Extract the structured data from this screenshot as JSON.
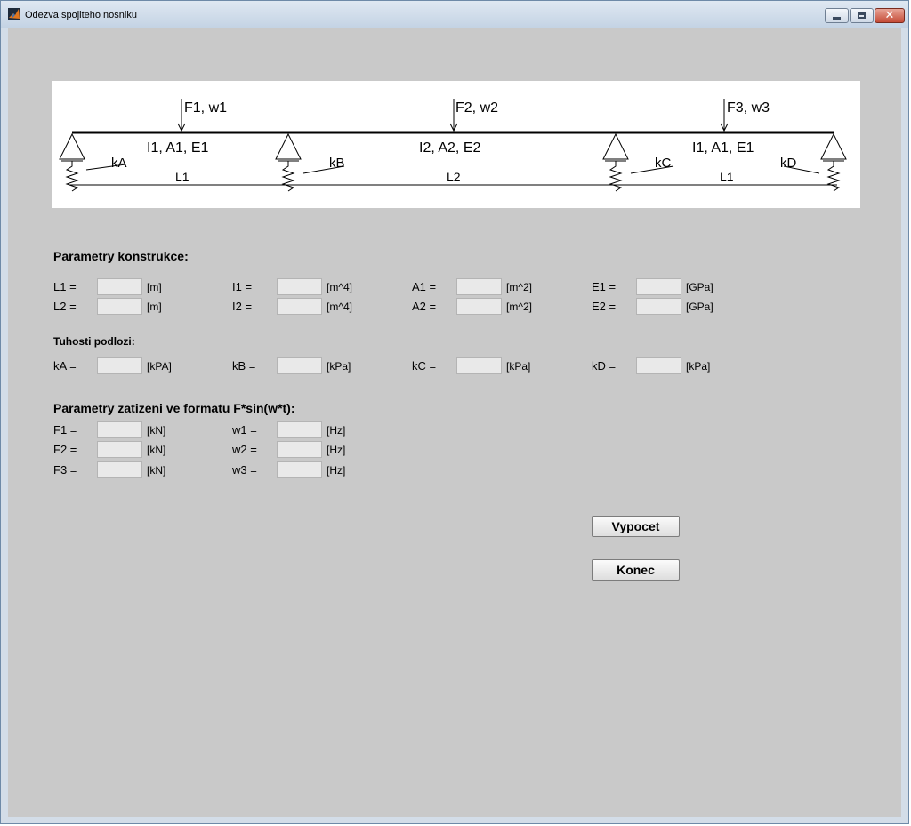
{
  "window": {
    "title": "Odezva spojiteho nosniku",
    "close_glyph": "✕"
  },
  "diagram": {
    "loads": [
      "F1, w1",
      "F2, w2",
      "F3, w3"
    ],
    "span_props": [
      "I1, A1, E1",
      "I2, A2, E2",
      "I1, A1, E1"
    ],
    "springs": [
      "kA",
      "kB",
      "kC",
      "kD"
    ],
    "lengths": [
      "L1",
      "L2",
      "L1"
    ]
  },
  "construction": {
    "heading": "Parametry konstrukce:",
    "rows": [
      [
        {
          "label": "L1 =",
          "unit": "[m]",
          "value": ""
        },
        {
          "label": "I1 =",
          "unit": "[m^4]",
          "value": ""
        },
        {
          "label": "A1 =",
          "unit": "[m^2]",
          "value": ""
        },
        {
          "label": "E1 =",
          "unit": "[GPa]",
          "value": ""
        }
      ],
      [
        {
          "label": "L2 =",
          "unit": "[m]",
          "value": ""
        },
        {
          "label": "I2 =",
          "unit": "[m^4]",
          "value": ""
        },
        {
          "label": "A2 =",
          "unit": "[m^2]",
          "value": ""
        },
        {
          "label": "E2 =",
          "unit": "[GPa]",
          "value": ""
        }
      ]
    ]
  },
  "foundation": {
    "heading": "Tuhosti podlozi:",
    "items": [
      {
        "label": "kA =",
        "unit": "[kPA]",
        "value": ""
      },
      {
        "label": "kB =",
        "unit": "[kPa]",
        "value": ""
      },
      {
        "label": "kC =",
        "unit": "[kPa]",
        "value": ""
      },
      {
        "label": "kD =",
        "unit": "[kPa]",
        "value": ""
      }
    ]
  },
  "loading": {
    "heading": "Parametry zatizeni ve formatu F*sin(w*t):",
    "forces": [
      {
        "label": "F1 =",
        "unit": "[kN]",
        "value": ""
      },
      {
        "label": "F2 =",
        "unit": "[kN]",
        "value": ""
      },
      {
        "label": "F3 =",
        "unit": "[kN]",
        "value": ""
      }
    ],
    "frequencies": [
      {
        "label": "w1 =",
        "unit": "[Hz]",
        "value": ""
      },
      {
        "label": "w2 =",
        "unit": "[Hz]",
        "value": ""
      },
      {
        "label": "w3 =",
        "unit": "[Hz]",
        "value": ""
      }
    ]
  },
  "buttons": {
    "compute": "Vypocet",
    "exit": "Konec"
  }
}
